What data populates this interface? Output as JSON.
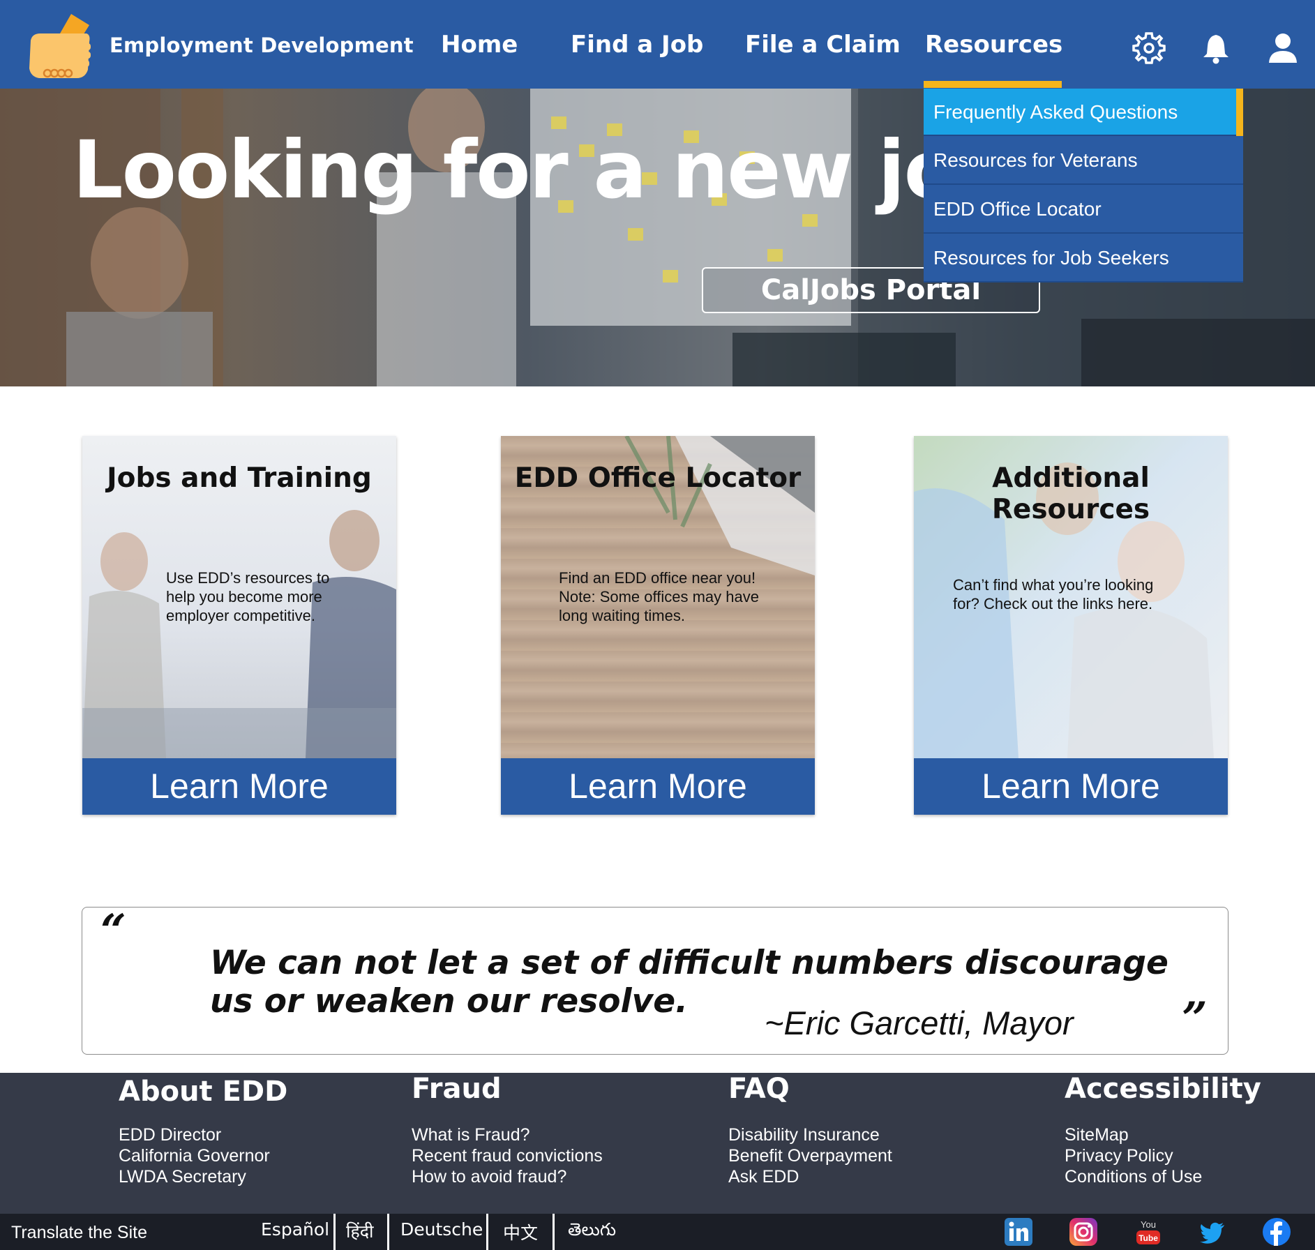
{
  "header": {
    "brand": "Employment Development",
    "nav": [
      "Home",
      "Find a Job",
      "File a Claim",
      "Resources"
    ],
    "active_nav": "Resources",
    "icons": [
      "gear-icon",
      "bell-icon",
      "user-icon"
    ],
    "accent_color": "#f5b51c",
    "bar_color": "#2a5ba3"
  },
  "dropdown": {
    "items": [
      "Frequently Asked Questions",
      "Resources for Veterans",
      "EDD Office Locator",
      "Resources for Job Seekers"
    ],
    "active_item": "Frequently Asked Questions"
  },
  "hero": {
    "title": "Looking for a new job?",
    "button": "CalJobs Portal"
  },
  "cards": [
    {
      "title": "Jobs and Training",
      "desc": [
        "Use EDD’s resources to",
        "help you become more",
        "employer competitive."
      ],
      "button": "Learn More"
    },
    {
      "title": "EDD Office Locator",
      "desc": [
        "Find an EDD office near you!",
        "Note: Some offices may have",
        "long waiting times."
      ],
      "button": "Learn More"
    },
    {
      "title": "Additional Resources",
      "desc": [
        "Can’t find what you’re looking",
        "for? Check out the links here."
      ],
      "button": "Learn More"
    }
  ],
  "quote": {
    "open": "“",
    "close": "”",
    "text": "We can not let a set of difficult numbers discourage us or weaken our resolve.",
    "author": "~Eric Garcetti, Mayor"
  },
  "footer": {
    "columns": [
      {
        "title": "About EDD",
        "links": [
          "EDD Director",
          "California Governor",
          "LWDA Secretary"
        ]
      },
      {
        "title": "Fraud",
        "links": [
          "What is Fraud?",
          "Recent fraud convictions",
          "How to avoid fraud?"
        ]
      },
      {
        "title": "FAQ",
        "links": [
          "Disability Insurance",
          "Benefit Overpayment",
          "Ask EDD"
        ]
      },
      {
        "title": "Accessibility",
        "links": [
          "SiteMap",
          "Privacy Policy",
          "Conditions of Use"
        ]
      }
    ],
    "translate_label": "Translate the Site",
    "languages": [
      "Español",
      "हिंदी",
      "Deutsche",
      "中文",
      "తెలుగు"
    ],
    "social": [
      "linkedin-icon",
      "instagram-icon",
      "youtube-icon",
      "twitter-icon",
      "facebook-icon"
    ]
  }
}
